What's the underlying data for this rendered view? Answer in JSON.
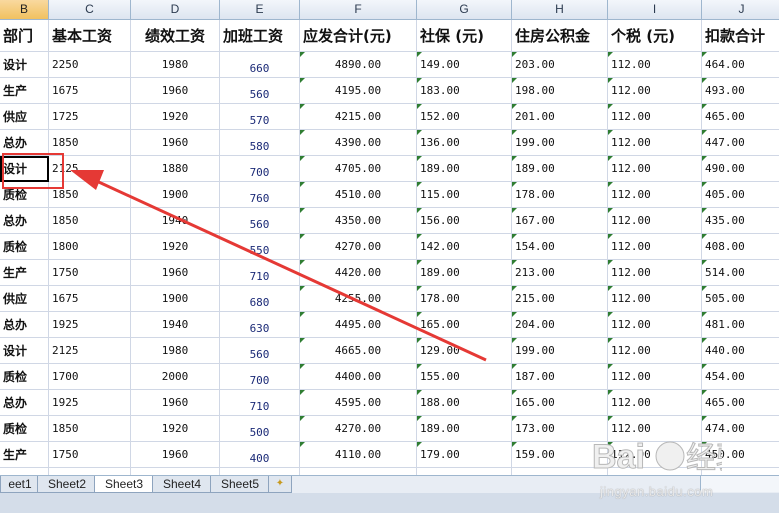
{
  "columns": [
    {
      "letter": "B",
      "selected": true
    },
    {
      "letter": "C"
    },
    {
      "letter": "D"
    },
    {
      "letter": "E"
    },
    {
      "letter": "F"
    },
    {
      "letter": "G"
    },
    {
      "letter": "H"
    },
    {
      "letter": "I"
    },
    {
      "letter": "J"
    }
  ],
  "headers": [
    "部门",
    "基本工资",
    "绩效工资",
    "加班工资",
    "应发合计(元)",
    "社保 (元)",
    "住房公积金",
    "个税 (元)",
    "扣款合计"
  ],
  "rows": [
    [
      "设计",
      "2250",
      "1980",
      "660",
      "4890.00",
      "149.00",
      "203.00",
      "112.00",
      "464.00"
    ],
    [
      "生产",
      "1675",
      "1960",
      "560",
      "4195.00",
      "183.00",
      "198.00",
      "112.00",
      "493.00"
    ],
    [
      "供应",
      "1725",
      "1920",
      "570",
      "4215.00",
      "152.00",
      "201.00",
      "112.00",
      "465.00"
    ],
    [
      "总办",
      "1850",
      "1960",
      "580",
      "4390.00",
      "136.00",
      "199.00",
      "112.00",
      "447.00"
    ],
    [
      "设计",
      "2125",
      "1880",
      "700",
      "4705.00",
      "189.00",
      "189.00",
      "112.00",
      "490.00"
    ],
    [
      "质检",
      "1850",
      "1900",
      "760",
      "4510.00",
      "115.00",
      "178.00",
      "112.00",
      "405.00"
    ],
    [
      "总办",
      "1850",
      "1940",
      "560",
      "4350.00",
      "156.00",
      "167.00",
      "112.00",
      "435.00"
    ],
    [
      "质检",
      "1800",
      "1920",
      "550",
      "4270.00",
      "142.00",
      "154.00",
      "112.00",
      "408.00"
    ],
    [
      "生产",
      "1750",
      "1960",
      "710",
      "4420.00",
      "189.00",
      "213.00",
      "112.00",
      "514.00"
    ],
    [
      "供应",
      "1675",
      "1900",
      "680",
      "4255.00",
      "178.00",
      "215.00",
      "112.00",
      "505.00"
    ],
    [
      "总办",
      "1925",
      "1940",
      "630",
      "4495.00",
      "165.00",
      "204.00",
      "112.00",
      "481.00"
    ],
    [
      "设计",
      "2125",
      "1980",
      "560",
      "4665.00",
      "129.00",
      "199.00",
      "112.00",
      "440.00"
    ],
    [
      "质检",
      "1700",
      "2000",
      "700",
      "4400.00",
      "155.00",
      "187.00",
      "112.00",
      "454.00"
    ],
    [
      "总办",
      "1925",
      "1960",
      "710",
      "4595.00",
      "188.00",
      "165.00",
      "112.00",
      "465.00"
    ],
    [
      "质检",
      "1850",
      "1920",
      "500",
      "4270.00",
      "189.00",
      "173.00",
      "112.00",
      "474.00"
    ],
    [
      "生产",
      "1750",
      "1960",
      "400",
      "4110.00",
      "179.00",
      "159.00",
      "112.00",
      "450.00"
    ]
  ],
  "sheet_tabs": [
    {
      "label": "eet1"
    },
    {
      "label": "Sheet2"
    },
    {
      "label": "Sheet3",
      "active": true
    },
    {
      "label": "Sheet4"
    },
    {
      "label": "Sheet5"
    }
  ],
  "new_sheet_icon": "insert-sheet-icon",
  "watermark": "jingyan.baidu.com",
  "colors": {
    "accent": "#e53935",
    "header_bg": "#dde5f0",
    "selected_header": "#f1c15f",
    "grid": "#d0d7e5"
  }
}
